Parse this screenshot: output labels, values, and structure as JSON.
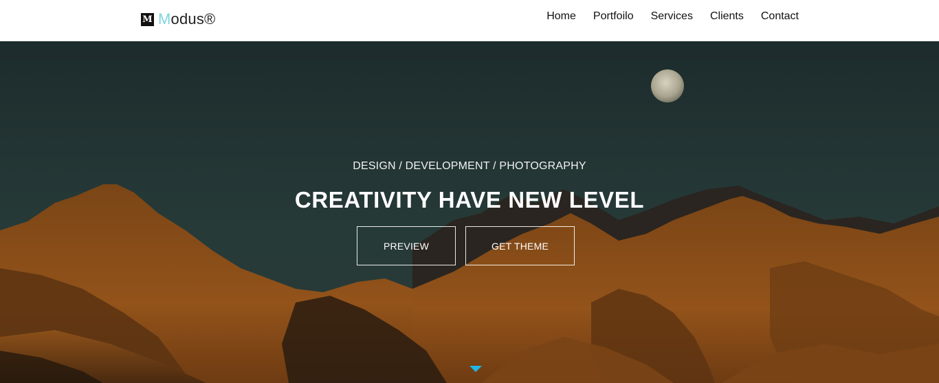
{
  "header": {
    "brand": {
      "mark": "M",
      "first_letter": "M",
      "rest": "odus®"
    },
    "nav": [
      "Home",
      "Portfoilo",
      "Services",
      "Clients",
      "Contact"
    ]
  },
  "hero": {
    "tagline": "DESIGN / DEVELOPMENT / PHOTOGRAPHY",
    "headline": "CREATIVITY HAVE NEW LEVEL",
    "buttons": {
      "preview": "PREVIEW",
      "get_theme": "GET THEME"
    },
    "scroll_icon": "triangle-down-icon"
  },
  "colors": {
    "accent": "#1fb6e8",
    "brand_accent": "#7fd3e3",
    "sky": "#223433",
    "mountain": "#8a4d17"
  }
}
